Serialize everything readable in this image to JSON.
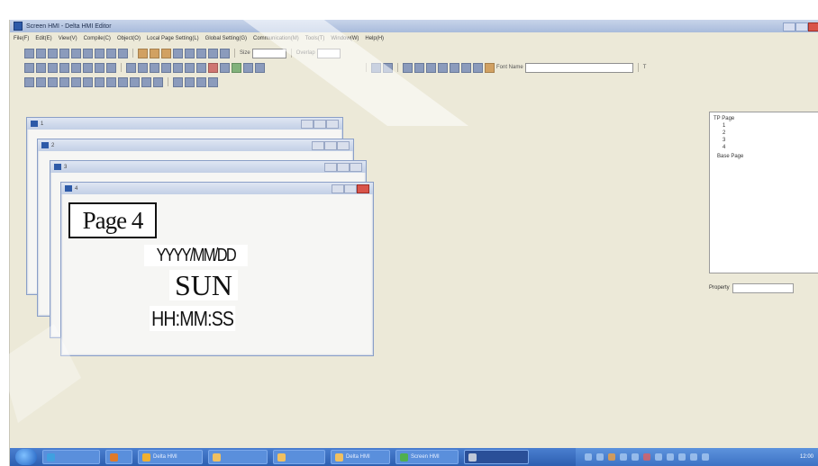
{
  "window": {
    "title": "Screen HMI - Delta HMI Editor",
    "controls": [
      "minimize",
      "maximize",
      "close"
    ]
  },
  "menu": [
    "File(F)",
    "Edit(E)",
    "View(V)",
    "Compile(C)",
    "Object(O)",
    "Local Page Setting(L)",
    "Global Setting(G)",
    "Communication(M)",
    "Tools(T)",
    "Window(W)",
    "Help(H)"
  ],
  "toolbar": {
    "row1_label_a": "Size",
    "row1_label_b": "Overlap",
    "row2_label": "Font Name",
    "row2_right": "T"
  },
  "pages": [
    {
      "title": "1"
    },
    {
      "title": "2"
    },
    {
      "title": "3"
    },
    {
      "title": "4",
      "content": {
        "page_label": "Page 4",
        "date_format": "YYYY/MM/DD",
        "day": "SUN",
        "time_format": "HH:MM:SS"
      }
    }
  ],
  "tree": {
    "root": "TP Page",
    "children": [
      "1",
      "2",
      "3",
      "4"
    ],
    "other": "Base Page"
  },
  "properties": {
    "label": "Property"
  },
  "taskbar": {
    "items": [
      "",
      "Delta HMI",
      "",
      "",
      "Delta HMI",
      "Screen HMI"
    ],
    "clock": "12:00"
  }
}
